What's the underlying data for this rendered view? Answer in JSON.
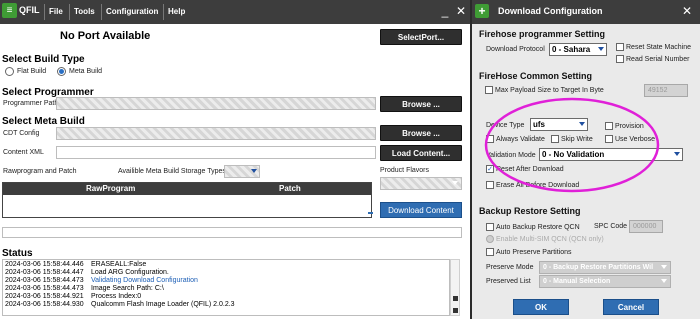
{
  "qfil": {
    "app_name": "QFIL",
    "menu": [
      "File",
      "Tools",
      "Configuration",
      "Help"
    ],
    "minimize": "_",
    "close": "✕",
    "port_status": "No Port Available",
    "select_port_label": "SelectPort...",
    "build_type": {
      "title": "Select Build Type",
      "flat_build": "Flat Build",
      "meta_build": "Meta Build"
    },
    "programmer": {
      "title": "Select Programmer",
      "path_label": "Programmer Path",
      "browse_label": "Browse ..."
    },
    "meta_build": {
      "title": "Select Meta Build",
      "cdt_config_label": "CDT Config",
      "browse_label": "Browse ...",
      "content_xml_label": "Content XML",
      "load_content_label": "Load Content...",
      "raw_patch_label": "Rawprogram and Patch",
      "storage_types_label": "Availible Meta Build Storage Types",
      "product_flavors_label": "Product Flavors"
    },
    "table": {
      "columns": [
        "RawProgram",
        "Patch"
      ]
    },
    "download_content_label": "Download Content",
    "status": {
      "title": "Status",
      "lines": [
        {
          "time": "2024-03-06 15:58:44.446",
          "msg": "ERASEALL:False",
          "highlight": false
        },
        {
          "time": "2024-03-06 15:58:44.447",
          "msg": "Load ARG Configuration.",
          "highlight": false
        },
        {
          "time": "2024-03-06 15:58:44.473",
          "msg": "Validating Download Configuration",
          "highlight": true
        },
        {
          "time": "2024-03-06 15:58:44.473",
          "msg": "Image Search Path: C:\\",
          "highlight": false
        },
        {
          "time": "2024-03-06 15:58:44.921",
          "msg": "Process Index:0",
          "highlight": false
        },
        {
          "time": "2024-03-06 15:58:44.930",
          "msg": "Qualcomm Flash Image Loader (QFIL) 2.0.2.3",
          "highlight": false
        }
      ]
    }
  },
  "dialog": {
    "title": "Download Configuration",
    "firehose_programmer": {
      "title": "Firehose programmer Setting",
      "download_protocol_label": "Download Protocol",
      "download_protocol_value": "0 - Sahara",
      "reset_state_machine": "Reset State Machine",
      "read_serial_number": "Read Serial Number"
    },
    "firehose_common": {
      "title": "FireHose Common Setting",
      "max_payload_label": "Max Payload Size to Target In Byte",
      "max_payload_value": "49152",
      "device_type_label": "Device Type",
      "device_type_value": "ufs",
      "provision": "Provision",
      "always_validate": "Always Validate",
      "skip_write": "Skip Write",
      "use_verbose": "Use Verbose",
      "validation_mode_label": "Validation Mode",
      "validation_mode_value": "0 - No Validation",
      "reset_after_download": "Reset After Download",
      "erase_all": "Erase All Before Download"
    },
    "backup_restore": {
      "title": "Backup Restore Setting",
      "auto_backup": "Auto Backup Restore QCN",
      "spc_code_label": "SPC Code",
      "spc_code_value": "000000",
      "enable_multi_sim": "Enable Multi-SIM QCN (QCN only)",
      "auto_preserve": "Auto Preserve Partitions",
      "preserve_mode_label": "Preserve Mode",
      "preserve_mode_value": "0 - Backup Restore Partitions Wil",
      "preserved_list_label": "Preserved List",
      "preserved_list_value": "0 - Manual Selection"
    },
    "ok_label": "OK",
    "cancel_label": "Cancel",
    "accent_color": "#e020d8"
  }
}
